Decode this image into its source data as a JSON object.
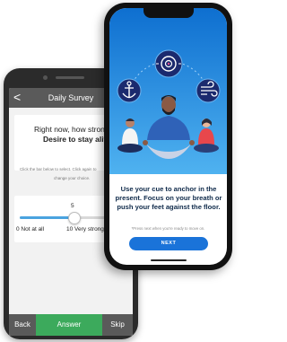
{
  "back_phone": {
    "header": {
      "back_glyph": "<",
      "title": "Daily Survey"
    },
    "question": {
      "line1": "Right now, how strong is your",
      "line2": "Desire to stay alive"
    },
    "instruction": {
      "line1": "Click the bar below to select. Click again to",
      "line2": "change your choice."
    },
    "slider": {
      "value": "5",
      "min_label": "0 Not at all",
      "max_label": "10 Very strong",
      "fraction": 0.5
    },
    "footer": {
      "back": "Back",
      "answer": "Answer",
      "skip": "Skip"
    }
  },
  "front_phone": {
    "message": "Use your cue to anchor in the present. Focus on your breath or push your feet against the floor.",
    "hint": "*Press next when you're ready to move on.",
    "next": "NEXT",
    "icons": [
      "anchor-icon",
      "target-icon",
      "wind-icon"
    ],
    "colors": {
      "accent": "#1a73d9",
      "sky_top": "#0e6fd0",
      "sky_bottom": "#4fb2f0",
      "text": "#0f2a4a",
      "answer": "#3caa5c"
    }
  }
}
